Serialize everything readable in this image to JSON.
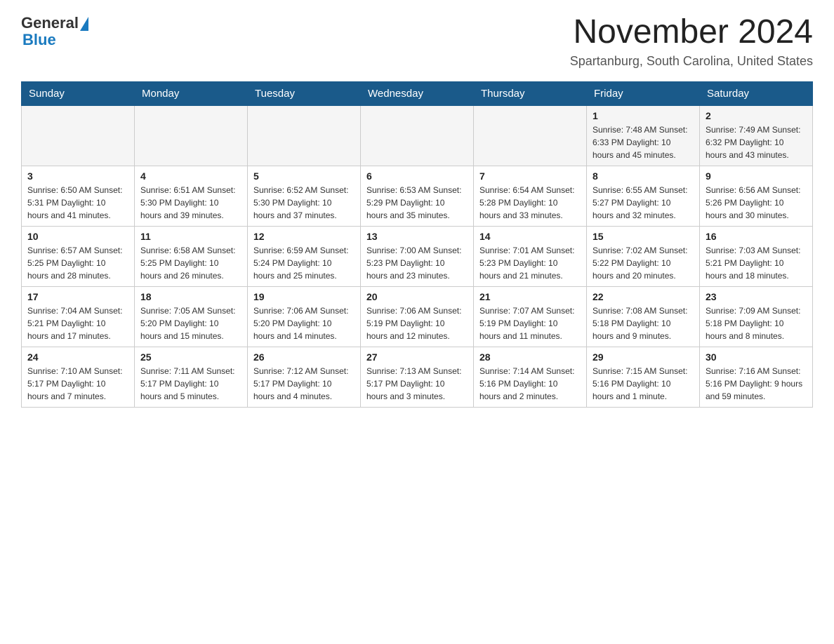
{
  "logo": {
    "general": "General",
    "blue": "Blue"
  },
  "title": "November 2024",
  "location": "Spartanburg, South Carolina, United States",
  "days_of_week": [
    "Sunday",
    "Monday",
    "Tuesday",
    "Wednesday",
    "Thursday",
    "Friday",
    "Saturday"
  ],
  "weeks": [
    [
      {
        "day": "",
        "info": ""
      },
      {
        "day": "",
        "info": ""
      },
      {
        "day": "",
        "info": ""
      },
      {
        "day": "",
        "info": ""
      },
      {
        "day": "",
        "info": ""
      },
      {
        "day": "1",
        "info": "Sunrise: 7:48 AM\nSunset: 6:33 PM\nDaylight: 10 hours and 45 minutes."
      },
      {
        "day": "2",
        "info": "Sunrise: 7:49 AM\nSunset: 6:32 PM\nDaylight: 10 hours and 43 minutes."
      }
    ],
    [
      {
        "day": "3",
        "info": "Sunrise: 6:50 AM\nSunset: 5:31 PM\nDaylight: 10 hours and 41 minutes."
      },
      {
        "day": "4",
        "info": "Sunrise: 6:51 AM\nSunset: 5:30 PM\nDaylight: 10 hours and 39 minutes."
      },
      {
        "day": "5",
        "info": "Sunrise: 6:52 AM\nSunset: 5:30 PM\nDaylight: 10 hours and 37 minutes."
      },
      {
        "day": "6",
        "info": "Sunrise: 6:53 AM\nSunset: 5:29 PM\nDaylight: 10 hours and 35 minutes."
      },
      {
        "day": "7",
        "info": "Sunrise: 6:54 AM\nSunset: 5:28 PM\nDaylight: 10 hours and 33 minutes."
      },
      {
        "day": "8",
        "info": "Sunrise: 6:55 AM\nSunset: 5:27 PM\nDaylight: 10 hours and 32 minutes."
      },
      {
        "day": "9",
        "info": "Sunrise: 6:56 AM\nSunset: 5:26 PM\nDaylight: 10 hours and 30 minutes."
      }
    ],
    [
      {
        "day": "10",
        "info": "Sunrise: 6:57 AM\nSunset: 5:25 PM\nDaylight: 10 hours and 28 minutes."
      },
      {
        "day": "11",
        "info": "Sunrise: 6:58 AM\nSunset: 5:25 PM\nDaylight: 10 hours and 26 minutes."
      },
      {
        "day": "12",
        "info": "Sunrise: 6:59 AM\nSunset: 5:24 PM\nDaylight: 10 hours and 25 minutes."
      },
      {
        "day": "13",
        "info": "Sunrise: 7:00 AM\nSunset: 5:23 PM\nDaylight: 10 hours and 23 minutes."
      },
      {
        "day": "14",
        "info": "Sunrise: 7:01 AM\nSunset: 5:23 PM\nDaylight: 10 hours and 21 minutes."
      },
      {
        "day": "15",
        "info": "Sunrise: 7:02 AM\nSunset: 5:22 PM\nDaylight: 10 hours and 20 minutes."
      },
      {
        "day": "16",
        "info": "Sunrise: 7:03 AM\nSunset: 5:21 PM\nDaylight: 10 hours and 18 minutes."
      }
    ],
    [
      {
        "day": "17",
        "info": "Sunrise: 7:04 AM\nSunset: 5:21 PM\nDaylight: 10 hours and 17 minutes."
      },
      {
        "day": "18",
        "info": "Sunrise: 7:05 AM\nSunset: 5:20 PM\nDaylight: 10 hours and 15 minutes."
      },
      {
        "day": "19",
        "info": "Sunrise: 7:06 AM\nSunset: 5:20 PM\nDaylight: 10 hours and 14 minutes."
      },
      {
        "day": "20",
        "info": "Sunrise: 7:06 AM\nSunset: 5:19 PM\nDaylight: 10 hours and 12 minutes."
      },
      {
        "day": "21",
        "info": "Sunrise: 7:07 AM\nSunset: 5:19 PM\nDaylight: 10 hours and 11 minutes."
      },
      {
        "day": "22",
        "info": "Sunrise: 7:08 AM\nSunset: 5:18 PM\nDaylight: 10 hours and 9 minutes."
      },
      {
        "day": "23",
        "info": "Sunrise: 7:09 AM\nSunset: 5:18 PM\nDaylight: 10 hours and 8 minutes."
      }
    ],
    [
      {
        "day": "24",
        "info": "Sunrise: 7:10 AM\nSunset: 5:17 PM\nDaylight: 10 hours and 7 minutes."
      },
      {
        "day": "25",
        "info": "Sunrise: 7:11 AM\nSunset: 5:17 PM\nDaylight: 10 hours and 5 minutes."
      },
      {
        "day": "26",
        "info": "Sunrise: 7:12 AM\nSunset: 5:17 PM\nDaylight: 10 hours and 4 minutes."
      },
      {
        "day": "27",
        "info": "Sunrise: 7:13 AM\nSunset: 5:17 PM\nDaylight: 10 hours and 3 minutes."
      },
      {
        "day": "28",
        "info": "Sunrise: 7:14 AM\nSunset: 5:16 PM\nDaylight: 10 hours and 2 minutes."
      },
      {
        "day": "29",
        "info": "Sunrise: 7:15 AM\nSunset: 5:16 PM\nDaylight: 10 hours and 1 minute."
      },
      {
        "day": "30",
        "info": "Sunrise: 7:16 AM\nSunset: 5:16 PM\nDaylight: 9 hours and 59 minutes."
      }
    ]
  ]
}
